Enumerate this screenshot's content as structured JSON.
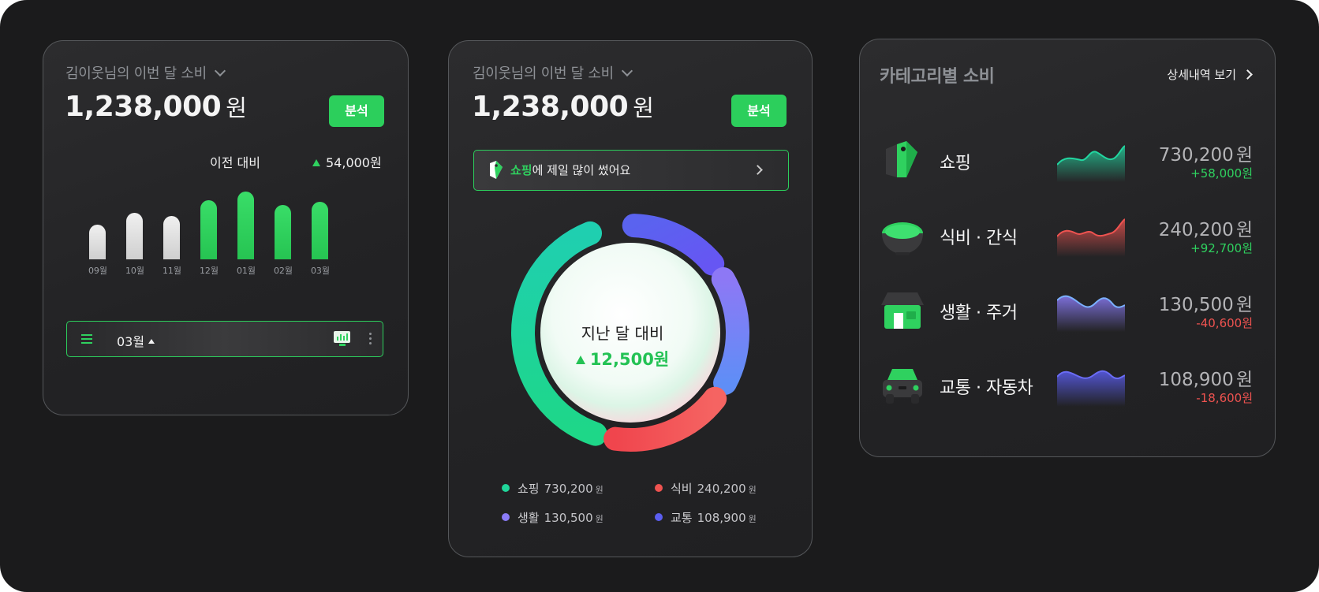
{
  "card1": {
    "owner_label": "김이웃님의 이번 달 소비",
    "amount": "1,238,000",
    "currency": "원",
    "analyze_button": "분석",
    "compare_label": "이전 대비",
    "compare_value": "54,000원",
    "chart_data": {
      "type": "bar",
      "categories": [
        "09월",
        "10월",
        "11월",
        "12월",
        "01월",
        "02월",
        "03월"
      ],
      "values": [
        44,
        59,
        55,
        75,
        86,
        69,
        73
      ],
      "colors": [
        "#e6e6e6",
        "#e6e6e6",
        "#e6e6e6",
        "#2fd15f",
        "#2fd15f",
        "#2fd15f",
        "#2fd15f"
      ]
    },
    "month_selector": "03월"
  },
  "card2": {
    "owner_label": "김이웃님의 이번 달 소비",
    "amount": "1,238,000",
    "currency": "원",
    "analyze_button": "분석",
    "banner_highlight": "쇼핑",
    "banner_text": "에 제일 많이 썼어요",
    "center_title": "지난 달 대비",
    "center_value": "12,500원",
    "chart_data": {
      "type": "pie",
      "style": "donut",
      "series": [
        {
          "name": "쇼핑",
          "value": 730200,
          "color": "#20d69a"
        },
        {
          "name": "식비",
          "value": 240200,
          "color": "#ef5350"
        },
        {
          "name": "생활",
          "value": 130500,
          "color": "#8b7cf8"
        },
        {
          "name": "교통",
          "value": 108900,
          "color": "#5b5ef0"
        }
      ]
    },
    "legend": [
      {
        "label": "쇼핑",
        "value": "730,200",
        "unit": "원",
        "color": "#20d69a"
      },
      {
        "label": "식비",
        "value": "240,200",
        "unit": "원",
        "color": "#ef5350"
      },
      {
        "label": "생활",
        "value": "130,500",
        "unit": "원",
        "color": "#8b7cf8"
      },
      {
        "label": "교통",
        "value": "108,900",
        "unit": "원",
        "color": "#5b5ef0"
      }
    ]
  },
  "card3": {
    "title": "카테고리별 소비",
    "detail_link": "상세내역 보기",
    "categories": [
      {
        "name": "쇼핑",
        "icon": "shopping-tag-icon",
        "amount": "730,200",
        "unit": "원",
        "delta": "+58,000원",
        "delta_color": "#2fd15f",
        "spark_color": "#22d6a0"
      },
      {
        "name": "식비 · 간식",
        "icon": "food-bowl-icon",
        "amount": "240,200",
        "unit": "원",
        "delta": "+92,700원",
        "delta_color": "#2fd15f",
        "spark_color": "#ef5350"
      },
      {
        "name": "생활 · 주거",
        "icon": "house-store-icon",
        "amount": "130,500",
        "unit": "원",
        "delta": "-40,600원",
        "delta_color": "#ef5350",
        "spark_color": "#8b7cf8"
      },
      {
        "name": "교통 · 자동차",
        "icon": "car-icon",
        "amount": "108,900",
        "unit": "원",
        "delta": "-18,600원",
        "delta_color": "#ef5350",
        "spark_color": "#5b5ef0"
      }
    ]
  }
}
